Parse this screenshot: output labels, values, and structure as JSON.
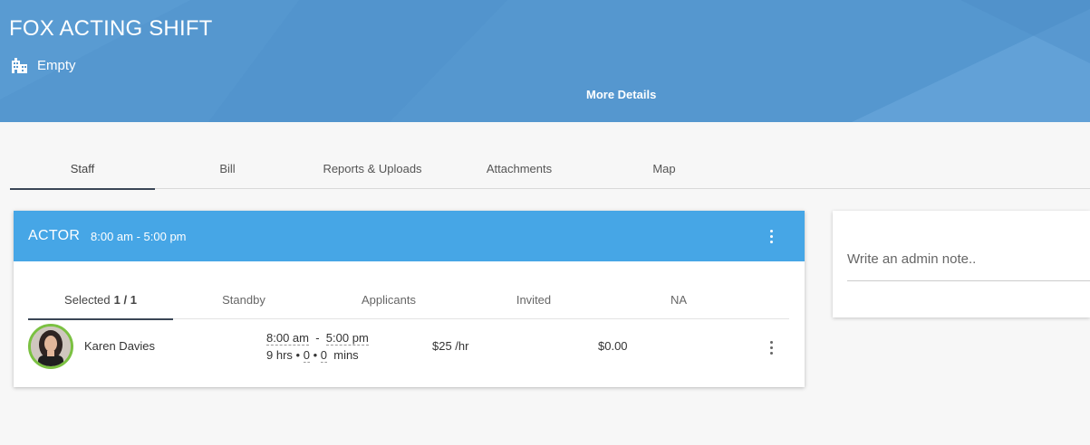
{
  "header": {
    "title": "FOX ACTING SHIFT",
    "venue_icon": "building-icon",
    "venue": "Empty",
    "more_details": "More Details",
    "background_color": "#5597cf"
  },
  "tabs": [
    {
      "label": "Staff",
      "active": true
    },
    {
      "label": "Bill",
      "active": false
    },
    {
      "label": "Reports & Uploads",
      "active": false
    },
    {
      "label": "Attachments",
      "active": false
    },
    {
      "label": "Map",
      "active": false
    }
  ],
  "position_card": {
    "role": "ACTOR",
    "shift_time": "8:00 am - 5:00 pm",
    "header_color": "#46a6e6",
    "menu_icon": "kebab-menu-icon",
    "subtabs": {
      "selected_label": "Selected",
      "selected_count": "1 / 1",
      "standby": "Standby",
      "applicants": "Applicants",
      "invited": "Invited",
      "na": "NA"
    },
    "staff": [
      {
        "name": "Karen Davies",
        "start": "8:00 am",
        "separator": "-",
        "end": "5:00 pm",
        "hours": "9 hrs",
        "dot": "•",
        "minutes_a": "0",
        "minutes_b": "0",
        "mins_label": "mins",
        "rate": "$25 /hr",
        "amount": "$0.00",
        "avatar_border_color": "#7bc142"
      }
    ]
  },
  "admin_note": {
    "placeholder": "Write an admin note.."
  }
}
